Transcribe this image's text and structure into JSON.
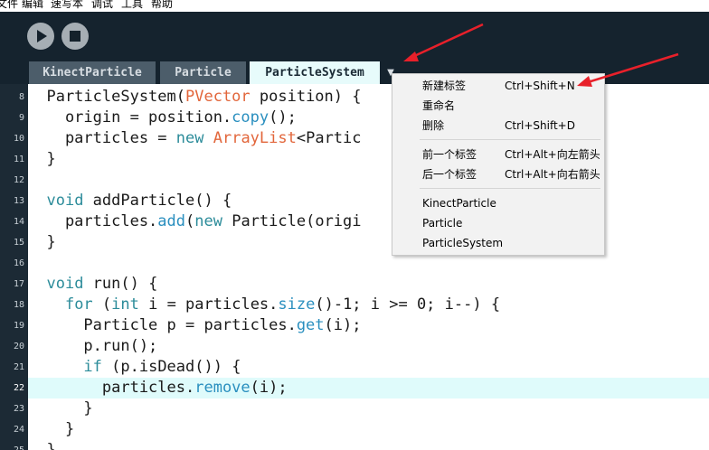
{
  "menubar": {
    "items": [
      "文件",
      "编辑",
      "速写本",
      "调试",
      "工具",
      "帮助"
    ]
  },
  "toolbar": {
    "run": "run",
    "stop": "stop"
  },
  "tabs": [
    {
      "label": "KinectParticle"
    },
    {
      "label": "Particle"
    },
    {
      "label": "ParticleSystem"
    }
  ],
  "tab_menu_arrow": "▼",
  "editor": {
    "current_line": 22,
    "lines": [
      {
        "num": "8"
      },
      {
        "num": "9"
      },
      {
        "num": "10"
      },
      {
        "num": "11"
      },
      {
        "num": "12"
      },
      {
        "num": "13"
      },
      {
        "num": "14"
      },
      {
        "num": "15"
      },
      {
        "num": "16"
      },
      {
        "num": "17"
      },
      {
        "num": "18"
      },
      {
        "num": "19"
      },
      {
        "num": "20"
      },
      {
        "num": "21"
      },
      {
        "num": "22"
      },
      {
        "num": "23"
      },
      {
        "num": "24"
      },
      {
        "num": "25"
      }
    ],
    "code": {
      "l8": [
        {
          "t": "  ParticleSystem("
        },
        {
          "t": "PVector",
          "c": "ty"
        },
        {
          "t": " position) {"
        }
      ],
      "l9": [
        {
          "t": "    origin = position."
        },
        {
          "t": "copy",
          "c": "fn"
        },
        {
          "t": "();"
        }
      ],
      "l10": [
        {
          "t": "    particles = "
        },
        {
          "t": "new",
          "c": "kw"
        },
        {
          "t": " "
        },
        {
          "t": "ArrayList",
          "c": "ty"
        },
        {
          "t": "<Partic"
        }
      ],
      "l11": [
        {
          "t": "  }"
        }
      ],
      "l12": [
        {
          "t": ""
        }
      ],
      "l13": [
        {
          "t": "  "
        },
        {
          "t": "void",
          "c": "kw"
        },
        {
          "t": " addParticle() {"
        }
      ],
      "l14": [
        {
          "t": "    particles."
        },
        {
          "t": "add",
          "c": "fn"
        },
        {
          "t": "("
        },
        {
          "t": "new",
          "c": "kw"
        },
        {
          "t": " Particle(origi"
        }
      ],
      "l15": [
        {
          "t": "  }"
        }
      ],
      "l16": [
        {
          "t": ""
        }
      ],
      "l17": [
        {
          "t": "  "
        },
        {
          "t": "void",
          "c": "kw"
        },
        {
          "t": " run() {"
        }
      ],
      "l18": [
        {
          "t": "    "
        },
        {
          "t": "for",
          "c": "kw"
        },
        {
          "t": " ("
        },
        {
          "t": "int",
          "c": "kw"
        },
        {
          "t": " i = particles."
        },
        {
          "t": "size",
          "c": "fn"
        },
        {
          "t": "()-1; i >= 0; i--) {"
        }
      ],
      "l19": [
        {
          "t": "      Particle p = particles."
        },
        {
          "t": "get",
          "c": "fn"
        },
        {
          "t": "(i);"
        }
      ],
      "l20": [
        {
          "t": "      p.run();"
        }
      ],
      "l21": [
        {
          "t": "      "
        },
        {
          "t": "if",
          "c": "kw"
        },
        {
          "t": " (p.isDead()) {"
        }
      ],
      "l22": [
        {
          "t": "        particles."
        },
        {
          "t": "remove",
          "c": "fn"
        },
        {
          "t": "(i);"
        }
      ],
      "l23": [
        {
          "t": "      }"
        }
      ],
      "l24": [
        {
          "t": "    }"
        }
      ],
      "l25": [
        {
          "t": "  }"
        }
      ]
    }
  },
  "context_menu": {
    "items": [
      {
        "label": "新建标签",
        "shortcut": "Ctrl+Shift+N"
      },
      {
        "label": "重命名",
        "shortcut": ""
      },
      {
        "label": "删除",
        "shortcut": "Ctrl+Shift+D"
      },
      {
        "label": "前一个标签",
        "shortcut": "Ctrl+Alt+向左箭头"
      },
      {
        "label": "后一个标签",
        "shortcut": "Ctrl+Alt+向右箭头"
      },
      {
        "label": "KinectParticle",
        "shortcut": ""
      },
      {
        "label": "Particle",
        "shortcut": ""
      },
      {
        "label": "ParticleSystem",
        "shortcut": ""
      }
    ]
  },
  "colors": {
    "toolbar_bg": "#15232e",
    "tab_inactive": "#4c5d6a",
    "tab_active": "#e7fbfb",
    "keyword": "#2c8c9a",
    "type": "#e2663b",
    "function": "#2a8fbf",
    "annotation_arrow": "#e8202a"
  }
}
